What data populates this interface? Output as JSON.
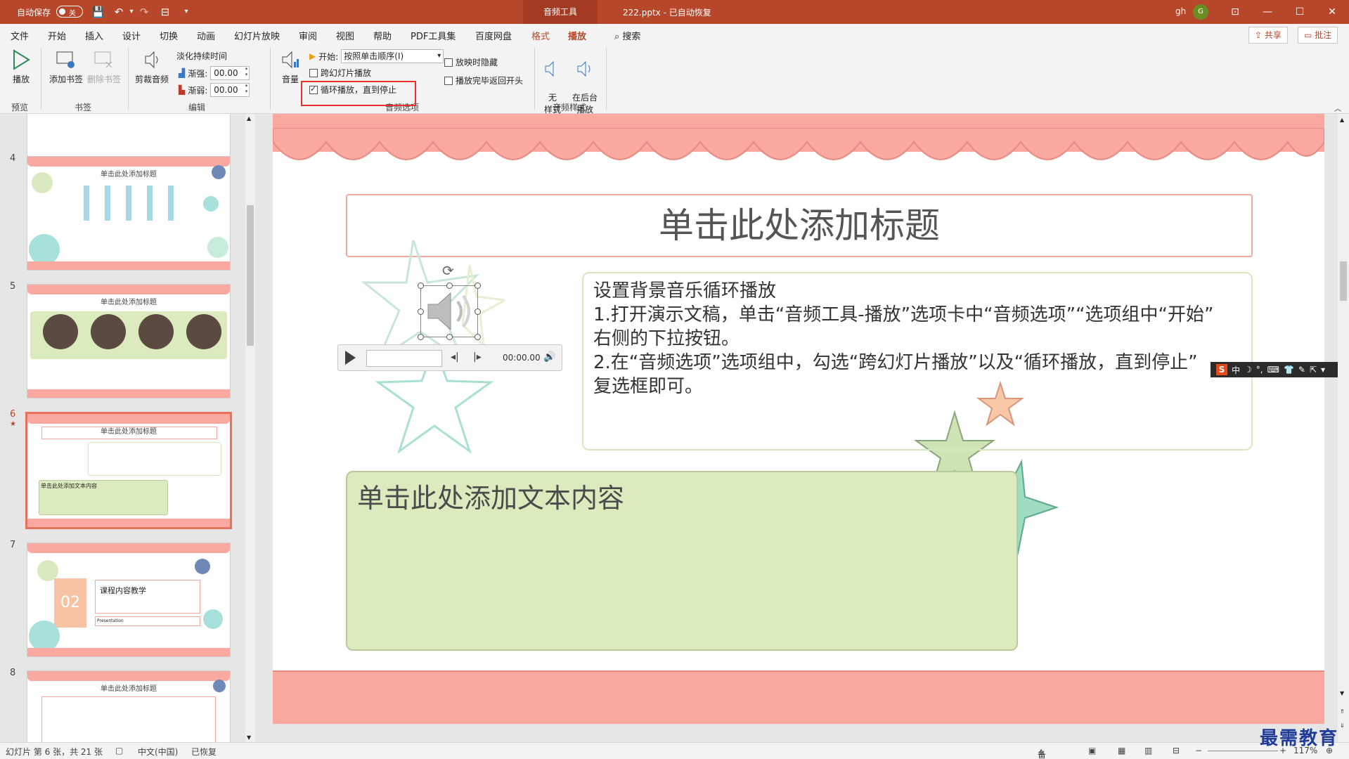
{
  "titlebar": {
    "autosave_label": "自动保存",
    "autosave_state": "关",
    "context_tab": "音频工具",
    "doc_title": "222.pptx  -  已自动恢复",
    "user": "gh",
    "avatar": "G"
  },
  "tabs": [
    "文件",
    "开始",
    "插入",
    "设计",
    "切换",
    "动画",
    "幻灯片放映",
    "审阅",
    "视图",
    "帮助",
    "PDF工具集",
    "百度网盘",
    "格式",
    "播放"
  ],
  "search_label": "搜索",
  "share_label": "共享",
  "comment_label": "批注",
  "ribbon": {
    "preview": {
      "play": "播放",
      "group": "预览"
    },
    "bookmarks": {
      "add": "添加书签",
      "remove": "删除书签",
      "group": "书签"
    },
    "editing": {
      "trim": "剪裁音频",
      "fade_title": "淡化持续时间",
      "fade_in_label": "渐强:",
      "fade_in_value": "00.00",
      "fade_out_label": "渐弱:",
      "fade_out_value": "00.00",
      "group": "编辑"
    },
    "audio_options": {
      "volume": "音量",
      "start_label": "开始:",
      "start_value": "按照单击顺序(I)",
      "across_slides": "跨幻灯片播放",
      "loop": "循环播放，直到停止",
      "hide_during_show": "放映时隐藏",
      "rewind": "播放完毕返回开头",
      "group": "音频选项"
    },
    "audio_styles": {
      "none": "无\n样式",
      "background": "在后台\n播放",
      "group": "音频样式"
    }
  },
  "thumbnails": [
    {
      "num": "4",
      "title": "单击此处添加标题"
    },
    {
      "num": "5",
      "title": "单击此处添加标题"
    },
    {
      "num": "6",
      "title": "单击此处添加标题",
      "star": "★",
      "body_line": "单击此处添加文本内容"
    },
    {
      "num": "7",
      "title": "课程内容教学",
      "badge": "02",
      "sub": "Presentation"
    },
    {
      "num": "8",
      "title": "单击此处添加标题"
    }
  ],
  "slide": {
    "title": "单击此处添加标题",
    "text_lines": [
      "设置背景音乐循环播放",
      "1.打开演示文稿，单击“音频工具-播放”选项卡中“音频选项”“选项组中“开始”",
      "右侧的下拉按钮。",
      "2.在“音频选项”选项组中，勾选“跨幻灯片播放”以及“循环播放，直到停止”",
      "复选框即可。"
    ],
    "content_placeholder": "单击此处添加文本内容",
    "player_time": "00:00.00"
  },
  "ime": {
    "lang": "中"
  },
  "status": {
    "slide_info": "幻灯片 第 6 张，共 21 张",
    "language": "中文(中国)",
    "recovered": "已恢复",
    "notes": "备注",
    "zoom": "117%"
  },
  "watermark": "最需教育",
  "colors": {
    "accent": "#b7472a",
    "pink": "#f9a9a0",
    "green": "#dcebbe"
  }
}
